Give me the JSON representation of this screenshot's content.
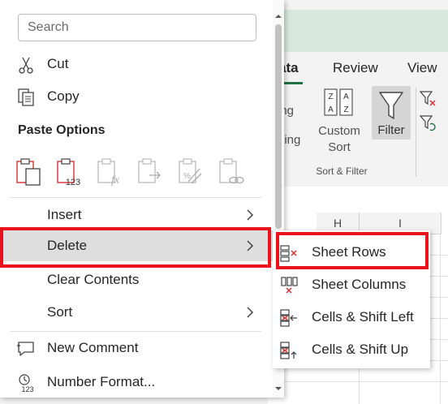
{
  "ribbon": {
    "tabs": [
      {
        "label": "ata",
        "active": true
      },
      {
        "label": "Review"
      },
      {
        "label": "View"
      }
    ],
    "partial_labels": [
      "ing",
      "ding"
    ],
    "custom_sort_label": "Custom Sort",
    "filter_label": "Filter",
    "group_label": "Sort & Filter",
    "accent": "#217346"
  },
  "sheet": {
    "columns": [
      "H",
      "I"
    ]
  },
  "context_menu": {
    "search_placeholder": "Search",
    "items": {
      "cut": {
        "label": "Cut",
        "icon": "scissors-icon"
      },
      "copy": {
        "label": "Copy",
        "icon": "copy-icon"
      },
      "paste_options_title": "Paste Options",
      "paste_options": [
        "paste-icon",
        "paste-values-icon",
        "paste-formulas-icon",
        "paste-transpose-icon",
        "paste-formatting-icon",
        "paste-link-icon"
      ],
      "insert": {
        "label": "Insert"
      },
      "delete": {
        "label": "Delete"
      },
      "clear_contents": {
        "label": "Clear Contents"
      },
      "sort": {
        "label": "Sort"
      },
      "new_comment": {
        "label": "New Comment",
        "icon": "comment-icon"
      },
      "number_format": {
        "label": "Number Format...",
        "icon": "number-format-icon"
      }
    }
  },
  "delete_submenu": {
    "items": [
      {
        "label": "Sheet Rows",
        "icon": "delete-sheet-rows-icon"
      },
      {
        "label": "Sheet Columns",
        "icon": "delete-sheet-columns-icon"
      },
      {
        "label": "Cells & Shift Left",
        "icon": "delete-cells-shift-left-icon"
      },
      {
        "label": "Cells & Shift Up",
        "icon": "delete-cells-shift-up-icon"
      }
    ]
  },
  "colors": {
    "highlight_box": "#e8131d",
    "hover": "#dedede",
    "icon_red": "#d13438"
  }
}
